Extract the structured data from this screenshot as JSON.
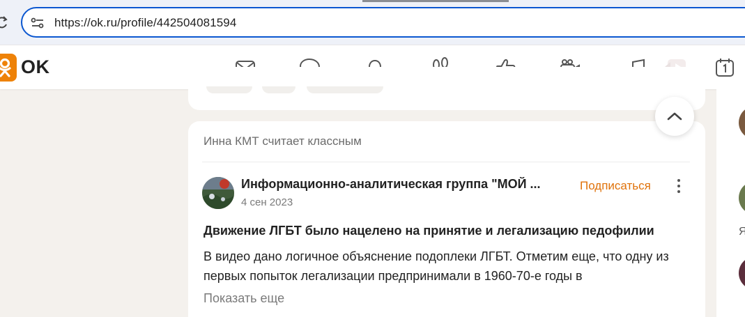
{
  "browser": {
    "url": "https://ok.ru/profile/442504081594"
  },
  "header": {
    "brand": "OK",
    "nav_icons": [
      "mail-icon",
      "chat-icon",
      "bell-icon",
      "footprints-icon",
      "thumbs-up-icon",
      "video-camera-icon",
      "music-icon",
      "play-video-icon",
      "calendar-icon"
    ]
  },
  "post": {
    "liker_line": "Инна КМТ считает классным",
    "group_name": "Информационно-аналитическая группа \"МОЙ ...",
    "date": "4 сен 2023",
    "subscribe_label": "Подписаться",
    "title": "Движение ЛГБТ было нацелено на принятие и легализацию педофилии",
    "text": "В видео дано логичное объяснение подоплеки ЛГБТ. Отметим еще, что одну из первых попыток легализации предпринимали в 1960-70-е годы в",
    "show_more_label": "Показать еще"
  },
  "right_column": {
    "partial_letter": "Я"
  },
  "colors": {
    "accent": "#ee8208",
    "subscribe": "#e0720a",
    "url_focus": "#0b57d0",
    "page_bg": "#f4f1ed"
  }
}
